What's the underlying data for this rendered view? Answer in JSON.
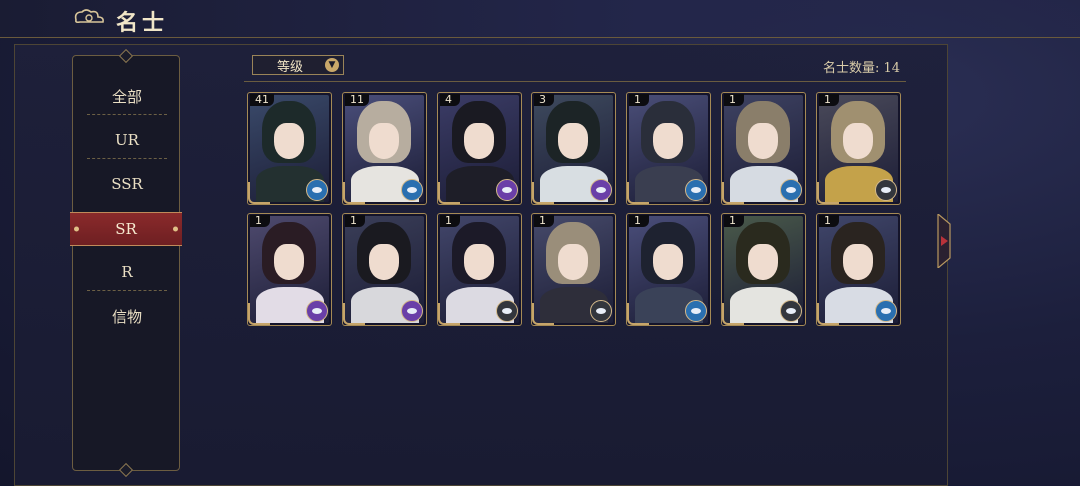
{
  "header": {
    "title": "名士"
  },
  "sidebar": {
    "items": [
      {
        "label": "全部",
        "active": false
      },
      {
        "label": "UR",
        "active": false
      },
      {
        "label": "SSR",
        "active": false
      },
      {
        "label": "SR",
        "active": true
      },
      {
        "label": "R",
        "active": false
      },
      {
        "label": "信物",
        "active": false
      }
    ]
  },
  "toolbar": {
    "filter_label": "等级",
    "count_text": "名士数量: 14"
  },
  "cards": [
    {
      "level": "41",
      "element_color": "#2a6fb0",
      "bg_color": "#3a4a6a",
      "hair_color": "#1d2a2a",
      "robe_color": "#233030"
    },
    {
      "level": "11",
      "element_color": "#2a6fb0",
      "bg_color": "#4a4e7a",
      "hair_color": "#b7ad9f",
      "robe_color": "#e6e4e0"
    },
    {
      "level": "4",
      "element_color": "#6a3fa8",
      "bg_color": "#3b3c66",
      "hair_color": "#1a1a22",
      "robe_color": "#1e1e28"
    },
    {
      "level": "3",
      "element_color": "#6a3fa8",
      "bg_color": "#3e4a5e",
      "hair_color": "#1c2426",
      "robe_color": "#d8dee2"
    },
    {
      "level": "1",
      "element_color": "#2a6fb0",
      "bg_color": "#4a4e78",
      "hair_color": "#2a2e3a",
      "robe_color": "#3a3e50"
    },
    {
      "level": "1",
      "element_color": "#2a6fb0",
      "bg_color": "#3e4262",
      "hair_color": "#8a7e6a",
      "robe_color": "#d6dbe2"
    },
    {
      "level": "1",
      "element_color": "#33363d",
      "bg_color": "#4a4a5a",
      "hair_color": "#a09070",
      "robe_color": "#c4a24a"
    },
    {
      "level": "1",
      "element_color": "#6a3fa8",
      "bg_color": "#4e4a6e",
      "hair_color": "#2a1c24",
      "robe_color": "#e2dce6"
    },
    {
      "level": "1",
      "element_color": "#6a3fa8",
      "bg_color": "#3a3e58",
      "hair_color": "#1a1a20",
      "robe_color": "#d8d8dc"
    },
    {
      "level": "1",
      "element_color": "#33363d",
      "bg_color": "#42466a",
      "hair_color": "#1c1a28",
      "robe_color": "#dcdae2"
    },
    {
      "level": "1",
      "element_color": "#33363d",
      "bg_color": "#464a6a",
      "hair_color": "#9a8e7a",
      "robe_color": "#2e2e3a"
    },
    {
      "level": "1",
      "element_color": "#2a6fb0",
      "bg_color": "#4a4e7a",
      "hair_color": "#1e2230",
      "robe_color": "#3a4258"
    },
    {
      "level": "1",
      "element_color": "#33363d",
      "bg_color": "#4a5a4a",
      "hair_color": "#2a2a1e",
      "robe_color": "#e4e4e0"
    },
    {
      "level": "1",
      "element_color": "#2a6fb0",
      "bg_color": "#40466a",
      "hair_color": "#2a2420",
      "robe_color": "#d8dce4"
    }
  ]
}
